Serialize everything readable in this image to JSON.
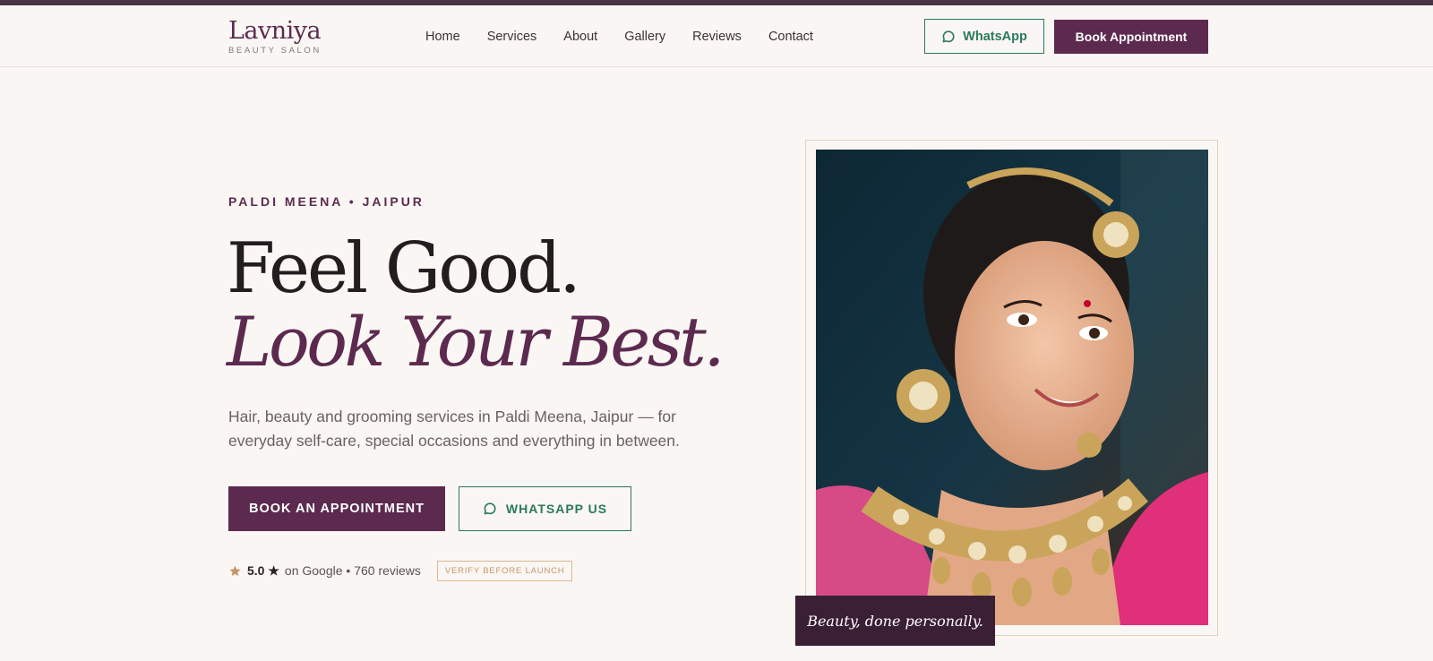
{
  "brand": {
    "name": "Lavniya",
    "tagline": "BEAUTY SALON"
  },
  "nav": {
    "items": [
      {
        "label": "Home"
      },
      {
        "label": "Services"
      },
      {
        "label": "About"
      },
      {
        "label": "Gallery"
      },
      {
        "label": "Reviews"
      },
      {
        "label": "Contact"
      }
    ],
    "whatsapp_label": "WhatsApp",
    "book_label": "Book Appointment"
  },
  "hero": {
    "eyebrow": "PALDI MEENA • JAIPUR",
    "headline_1": "Feel Good.",
    "headline_2": "Look Your Best.",
    "lede": "Hair, beauty and grooming services in Paldi Meena, Jaipur — for everyday self-care, special occasions and everything in between.",
    "cta_book": "BOOK AN APPOINTMENT",
    "cta_whatsapp": "WHATSAPP US",
    "rating": {
      "score": "5.0 ★",
      "source": "on Google • 760 reviews",
      "badge": "VERIFY BEFORE LAUNCH"
    },
    "photo_caption": "Beauty, done personally."
  },
  "icons": {
    "whatsapp": "chat-bubble-icon",
    "star": "star-icon"
  },
  "colors": {
    "brand": "#5c2a4f",
    "whatsapp": "#2a7a5a",
    "background": "#faf6f3",
    "accent_gold": "#c7966a"
  }
}
